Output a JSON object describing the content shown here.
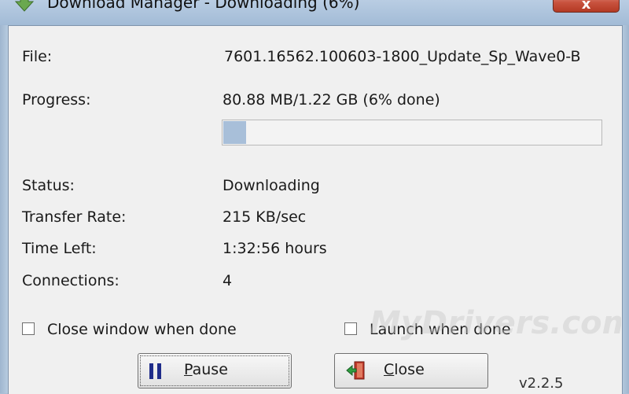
{
  "window": {
    "title": "Download Manager - Downloading (6%)",
    "close_glyph": "x"
  },
  "fields": {
    "file_label": "File:",
    "file_value": "7601.16562.100603-1800_Update_Sp_Wave0-B",
    "progress_label": "Progress:",
    "progress_value": "80.88 MB/1.22 GB (6% done)",
    "progress_fraction": 0.06,
    "status_label": "Status:",
    "status_value": "Downloading",
    "rate_label": "Transfer Rate:",
    "rate_value": "215 KB/sec",
    "time_label": "Time Left:",
    "time_value": "1:32:56 hours",
    "connections_label": "Connections:",
    "connections_value": "4"
  },
  "options": {
    "close_when_done_label": "Close window when done",
    "launch_when_done_label": "Launch when done"
  },
  "buttons": {
    "pause_underlined": "P",
    "pause_rest": "ause",
    "close_underlined": "C",
    "close_rest": "lose"
  },
  "version": "v2.2.5",
  "watermark": "MyDrivers.com",
  "colors": {
    "progress_fill": "#a8bfd9",
    "pause_icon": "#1f2c8a",
    "close_icon_door": "#c0392b",
    "close_icon_arrow": "#2e9e3f"
  }
}
